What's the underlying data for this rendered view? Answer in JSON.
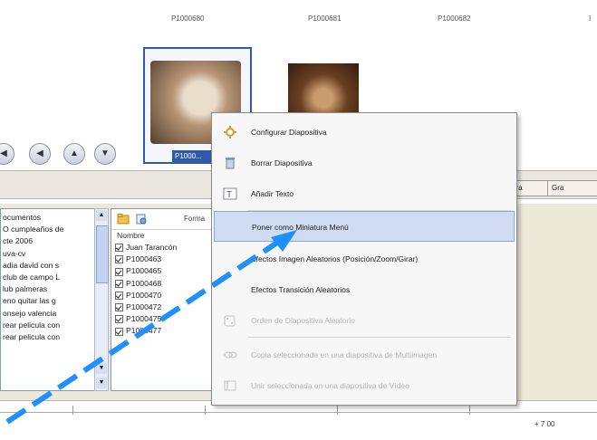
{
  "slides": {
    "labels": [
      "P1000680",
      "P1000681",
      "P1000682"
    ],
    "selected_caption": "P1000..."
  },
  "nav_buttons": [
    "◀",
    "◀",
    "▲",
    "▼"
  ],
  "column_headers": [
    "ura",
    "Gra"
  ],
  "folders": [
    "ocumentos",
    "O cumpleaños de",
    "cte 2006",
    "uva-cv",
    "adia david con s",
    "club de campo L",
    "lub palmeras",
    "eno quitar las g",
    "onsejo valencia",
    "rear pelicula con",
    "rear pelicula con"
  ],
  "file_panel": {
    "format_label": "Forma",
    "column_name": "Nombre",
    "items": [
      "Juan Tarancón",
      "P1000463",
      "P1000465",
      "P1000468",
      "P1000470",
      "P1000472",
      "P1000475",
      "P1000477"
    ]
  },
  "timeline": {
    "time_label": "+ 7 00"
  },
  "context_menu": {
    "items": [
      {
        "label": "Configurar Diapositiva",
        "icon": "gear-icon",
        "disabled": false
      },
      {
        "label": "Borrar Diapositiva",
        "icon": "trash-icon",
        "disabled": false
      },
      {
        "label": "Añadir Texto",
        "icon": "text-icon",
        "disabled": false
      },
      {
        "label": "Poner como Miniatura Menú",
        "icon": "",
        "disabled": false,
        "highlight": true
      },
      {
        "label": "Efectos Imagen Aleatorios (Posición/Zoom/Girar)",
        "icon": "",
        "disabled": false
      },
      {
        "label": "Efectos Transición Aleatorios",
        "icon": "",
        "disabled": false
      },
      {
        "label": "Orden de Diapositiva Aleatorio",
        "icon": "dice-icon",
        "disabled": true
      },
      {
        "label": "Copia seleccionada en una diapositiva de Multiimagen",
        "icon": "link-icon",
        "disabled": true
      },
      {
        "label": "Unir seleccionada en una diapositiva de Vídeo",
        "icon": "film-icon",
        "disabled": true
      }
    ]
  },
  "colors": {
    "selection_blue": "#2f5aa8",
    "menu_highlight": "#cfdcf1",
    "arrow": "#1e90ff"
  }
}
